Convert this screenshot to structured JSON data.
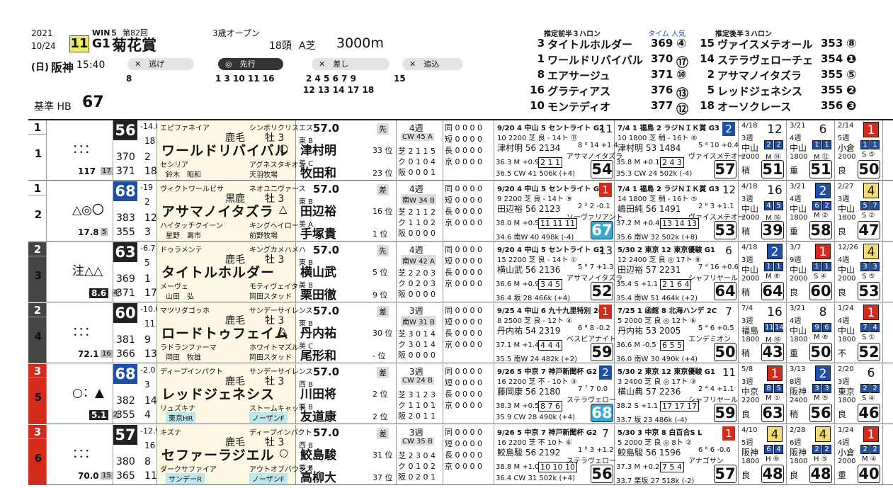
{
  "header": {
    "year": "2021",
    "date": "10/24",
    "win5": "WIN５",
    "race_count": "第82回",
    "race_num": "11",
    "grade": "G1",
    "race_name": "菊花賞",
    "day": "(日)",
    "venue": "阪神",
    "time": "15:40",
    "class": "3歳オープン",
    "heads": "18頭",
    "track": "A芝",
    "distance": "3000m",
    "base_label": "基準 HB",
    "base_value": "67"
  },
  "pace": {
    "nige_label": "逃げ",
    "nige_horses": "8",
    "senko_label": "先行",
    "senko_horses": "1 3 10 11 16",
    "sashi_label": "差し",
    "sashi_horses_1": "2 4 5 6 7 9",
    "sashi_horses_2": "12 13 14 17 18",
    "oikomi_label": "追込",
    "oikomi_horses": "15"
  },
  "rankings": {
    "first_half_title": "推定前半３ハロン",
    "time_label": "タイム 人気",
    "second_half_title": "推定後半３ハロン",
    "first_half": [
      {
        "num": "3",
        "name": "タイトルホルダー",
        "time": "369",
        "pop": "4"
      },
      {
        "num": "1",
        "name": "ワールドリバイバル",
        "time": "370",
        "pop": "17"
      },
      {
        "num": "8",
        "name": "エアサージュ",
        "time": "371",
        "pop": "10"
      },
      {
        "num": "16",
        "name": "グラティアス",
        "time": "376",
        "pop": "13"
      },
      {
        "num": "10",
        "name": "モンテディオ",
        "time": "377",
        "pop": "12"
      }
    ],
    "second_half": [
      {
        "num": "15",
        "name": "ヴァイスメテオール",
        "time": "353",
        "pop": "8"
      },
      {
        "num": "14",
        "name": "ステラヴェローチェ",
        "time": "354",
        "pop": "1"
      },
      {
        "num": "2",
        "name": "アサマノイタズラ",
        "time": "355",
        "pop": "5"
      },
      {
        "num": "5",
        "name": "レッドジェネシス",
        "time": "355",
        "pop": "2"
      },
      {
        "num": "18",
        "name": "オーソクレース",
        "time": "356",
        "pop": "3"
      }
    ]
  },
  "horses": [
    {
      "waku": "1",
      "umaban": "1",
      "marks": "：：：",
      "odds": "117",
      "pop": "17",
      "score": "56",
      "s1": "-14.0",
      "s2": "18",
      "s3": "370",
      "s3r": "2",
      "s4": "371",
      "s4r": "18",
      "sire": "エピファネイア",
      "dam_sire_top": "シンボリクリスエス",
      "coat": "鹿毛",
      "sex": "牡 3",
      "name": "ワールドリバイバル",
      "mark_end": "○",
      "dam": "セシリア",
      "dam_sire": "アグネスタキオン",
      "owner": "鈴木　昭和",
      "breeder": "天羽牧場",
      "weight": "57.0",
      "style": "先",
      "east_west": "東 B",
      "jockey": "津村明",
      "jrank": "33 位",
      "trainer_tag": "美 C",
      "trainer": "牧田和",
      "trank": "23 位",
      "rotation": "4週",
      "training": "CW 45 A",
      "stats": [
        "同 0 0 0 0",
        "短 0 0 0 0",
        "長 0 0 0 0",
        "芝 2 1 1 5",
        "京 0 0 0 0",
        "ク 0 1 0 4",
        "阪 0 0 0 1"
      ],
      "p1_head": "9/20  4 中山  5 セントライト  G2",
      "p1_pos": "11",
      "p1_l2": "10  2200  芝 良  -  14ト  ⑪",
      "p1_jockey": "津村明  56  2134",
      "p1_note": "8 ⁴ 14  +1.4",
      "p1_winner": "アサマノイタズラ",
      "p1_lap": "36.3  M +0.9",
      "p1_pass": "2 1 1",
      "p1_last": "36.5  CW 41  506k (+4)",
      "p1_score": "54",
      "p2_head": "7/4  1 福島  2 ラジＮＩＫ賞  G3",
      "p2_pos": "2",
      "p2_l2": "10  1800  芝 稍  -  16ト  ⑥",
      "p2_jockey": "津村明  53  1484",
      "p2_note": "5 ⁴ 10  +0.4",
      "p2_winner": "ヴァイスメテオー",
      "p2_lap": "35.8  M +0.1",
      "p2_pass": "2 4 3",
      "p2_last": "35.3  CW 24  502k (-4)",
      "p2_score": "57",
      "h3": {
        "date": "4/18",
        "n": "12",
        "w": "3週",
        "v": "中山",
        "d": "2000",
        "g": "稍",
        "sc": "51",
        "b1": "2",
        "b2": "2",
        "m": "M ⑭"
      },
      "h4": {
        "date": "3/21",
        "n": "6",
        "w": "4週",
        "v": "中山",
        "d": "1800",
        "g": "重",
        "sc": "51",
        "b1": "1",
        "b2": "1",
        "m": "M ⑫"
      },
      "h5": {
        "date": "2/14",
        "n": "1",
        "w": "5週",
        "v": "小倉",
        "d": "2000",
        "g": "良",
        "sc": "50",
        "b1": "1",
        "b2": "1",
        "m": "S ⑤"
      }
    },
    {
      "waku": "1",
      "umaban": "2",
      "marks": "△◎〇",
      "odds": "17.8",
      "pop": "5",
      "score": "68",
      "s1": "-19",
      "s2": "2",
      "s3": "383",
      "s3r": "12",
      "s4": "355",
      "s4r": "3",
      "sire": "ヴィクトワールピサ",
      "dam_sire_top": "ネオユニヴァース",
      "coat": "黒鹿",
      "sex": "牡 3",
      "name": "アサマノイタズラ",
      "mark_end": "△",
      "dam": "ハイタッチクイーン",
      "dam_sire": "キングヘイロー",
      "owner": "星野　壽市",
      "breeder": "前野牧場",
      "weight": "57.0",
      "style": "差",
      "east_west": "東 B",
      "jockey": "田辺裕",
      "jrank": "16 位",
      "trainer_tag": "美 A",
      "trainer": "手塚貴",
      "trank": "1 位",
      "rotation": "4週",
      "training": "南W 34 B",
      "stats": [
        "同 0 0 0 0",
        "短 0 0 0 0",
        "長 0 0 0 0",
        "芝 2 1 1 2",
        "京 0 0 0 0",
        "ク 1 1 0 2",
        "阪 0 0 0 0"
      ],
      "p1_head": "9/20  4 中山  5 セントライト  G2",
      "p1_pos": "1",
      "p1_l2": "9  2200  芝 良  -  14ト  ⑨",
      "p1_jockey": "田辺裕  56  2123",
      "p1_note": "2 ² 2  -0.1",
      "p1_winner": "ソーヴァリアント",
      "p1_lap": "38.0  M +0.5",
      "p1_pass": "11 11 11",
      "p1_last": "34.6  南W 40  498k (-4)",
      "p1_score": "67",
      "p2_head": "7/4  1 福島  2 ラジＮＩＫ賞  G3",
      "p2_pos": "12",
      "p2_l2": "14  1800  芝 稍  -  16ト  ⑤",
      "p2_jockey": "嶋田純  56  1491",
      "p2_note": "2 ⁸ 3  +1.1",
      "p2_winner": "ヴァイスメテオー",
      "p2_lap": "37.2  M +0.4",
      "p2_pass": "13 14 13",
      "p2_last": "35.6  南W 32  502k (+8)",
      "p2_score": "53",
      "h3": {
        "date": "4/18",
        "n": "16",
        "w": "3週",
        "v": "中山",
        "d": "2000",
        "g": "稍",
        "sc": "39",
        "b1": "4",
        "b2": "5",
        "m": "M ⑯"
      },
      "h4": {
        "date": "3/21",
        "n": "2",
        "w": "4週",
        "v": "中山",
        "d": "1800",
        "g": "重",
        "sc": "58",
        "b1": "6",
        "b2": "2",
        "m": "M ②"
      },
      "h5": {
        "date": "2/27",
        "n": "4",
        "w": "3週",
        "v": "中山",
        "d": "1800",
        "g": "良",
        "sc": "47",
        "b1": "5",
        "b2": "7",
        "m": "S ②"
      }
    },
    {
      "waku": "2",
      "umaban": "3",
      "marks": "注△△",
      "odds": "8.6",
      "pop": "4",
      "score": "63",
      "s1": "-6.7",
      "s2": "5",
      "s3": "369",
      "s3r": "1",
      "s4": "371",
      "s4r": "17",
      "sire": "ドゥラメンテ",
      "dam_sire_top": "キングカメハメハ",
      "coat": "鹿毛",
      "sex": "牡 3",
      "name": "タイトルホルダー",
      "mark_end": "",
      "dam": "メーヴェ",
      "dam_sire": "モティヴェイター",
      "owner": "山田　弘",
      "breeder": "岡田スタッド",
      "weight": "57.0",
      "style": "先",
      "east_west": "東 B",
      "jockey": "横山武",
      "jrank": "5 位",
      "trainer_tag": "美 B",
      "trainer": "栗田徹",
      "trank": "9 位",
      "rotation": "4週",
      "training": "南W 42 A",
      "stats": [
        "同 0 0 0 0",
        "短 0 0 0 0",
        "長 0 0 0 0",
        "芝 2 2 0 3",
        "京 0 0 0 0",
        "ク 0 2 0 3",
        "阪 0 0 0 0"
      ],
      "p1_head": "9/20  4 中山  5 セントライト  G2",
      "p1_pos": "13",
      "p1_l2": "15  2200  芝 良  -  14ト  ①",
      "p1_jockey": "横山武  56  2136",
      "p1_note": "5 ⁸ 7  +1.3",
      "p1_winner": "アサマノイタズラ",
      "p1_lap": "36.6  M +0.9",
      "p1_pass": "3 4 5",
      "p1_last": "36.4  坂 28  466k (+4)",
      "p1_score": "52",
      "p2_head": "5/30  2 東京  12 東京優駿  G1",
      "p2_pos": "6",
      "p2_l2": "12  2400  芝 良  ◎  17ト  ⑧",
      "p2_jockey": "田辺裕  57  2231",
      "p2_note": "7 ⁴ 16  +0.6",
      "p2_winner": "シャフリヤール",
      "p2_lap": "35.4  S +1.1",
      "p2_pass": "2 1 6 4",
      "p2_last": "35.4  南W 51  464k (+2)",
      "p2_score": "64",
      "h3": {
        "date": "4/18",
        "n": "2",
        "w": "3週",
        "v": "中山",
        "d": "2000",
        "g": "稍",
        "sc": "64",
        "b1": "1",
        "b2": "1",
        "m": "M ⑧"
      },
      "h4": {
        "date": "3/7",
        "n": "1",
        "w": "9週",
        "v": "中山",
        "d": "2000",
        "g": "良",
        "sc": "60",
        "b1": "1",
        "b2": "1",
        "m": "S ④"
      },
      "h5": {
        "date": "12/26",
        "n": "4",
        "w": "4週",
        "v": "中山",
        "d": "2000",
        "g": "良",
        "sc": "53",
        "b1": "3",
        "b2": "3",
        "m": "S ⑤"
      }
    },
    {
      "waku": "2",
      "umaban": "4",
      "marks": "：：：",
      "odds": "72.1",
      "pop": "16",
      "score": "60",
      "s1": "-10.0",
      "s2": "11",
      "s3": "381",
      "s3r": "9",
      "s4": "366",
      "s4r": "13",
      "sire": "マツリダゴッホ",
      "dam_sire_top": "サンデーサイレンス",
      "coat": "鹿毛",
      "sex": "牡 3",
      "name": "ロードトゥフェイム",
      "mark_end": "△",
      "dam": "ラドランファーマ",
      "dam_sire": "ホワイトマズル",
      "owner": "岡田　牧雄",
      "breeder": "岡田スタッド",
      "weight": "57.0",
      "style": "差",
      "east_west": "東 B",
      "jockey": "丹内祐",
      "jrank": "30 位",
      "trainer_tag": "美 C",
      "trainer": "尾形和",
      "trank": "- 位",
      "rotation": "3週",
      "training": "南W 31 B",
      "stats": [
        "同 0 0 0 0",
        "短 0 0 0 0",
        "長 0 0 0 0",
        "芝 3 0 1 4",
        "京 0 0 0 0",
        "ク 3 0 1 4",
        "阪 0 0 0 0"
      ],
      "p1_head": "9/25  4 中山  6 九十九里特別  2C",
      "p1_pos": "1",
      "p1_l2": "8  2500  芝 良  -  12ト  ④",
      "p1_jockey": "丹内祐  54  2319",
      "p1_note": "6 ⁸ 8  -0.2",
      "p1_winner": "ベスビアナイト",
      "p1_lap": "37.1  M +1.4",
      "p1_pass": "4 4 4",
      "p1_last": "35.5  南W 24  482k (+2)",
      "p1_score": "59",
      "p2_head": "7/25  1 函館  8 北海ハンデ  2C",
      "p2_pos": "7",
      "p2_l2": "5  2000  芝 良  ◎  12ト  ⑥",
      "p2_jockey": "丹内祐  53  2005",
      "p2_note": "5 ⁴ 6  +0.5",
      "p2_winner": "エンデミオン",
      "p2_lap": "36.6  M -0.5",
      "p2_pass": "6 5 5",
      "p2_last": "36.0  南W 30  490k (+4)",
      "p2_score": "50",
      "h3": {
        "date": "7/4",
        "n": "16",
        "w": "3週",
        "v": "福島",
        "d": "1800",
        "g": "稍",
        "sc": "43",
        "b1": "11",
        "b2": "14",
        "m": "M ⑯"
      },
      "h4": {
        "date": "3/21",
        "n": "8",
        "w": "4週",
        "v": "中山",
        "d": "1800",
        "g": "重",
        "sc": "50",
        "b1": "9",
        "b2": "6",
        "m": "M ⑧"
      },
      "h5": {
        "date": "1/24",
        "n": "1",
        "w": "4週",
        "v": "中山",
        "d": "1800",
        "g": "不",
        "sc": "52",
        "b1": "7",
        "b2": "4",
        "m": "S ①"
      }
    },
    {
      "waku": "3",
      "umaban": "5",
      "marks": "○：▲",
      "odds": "5.1",
      "pop": "2",
      "score": "68",
      "s1": "-2.0",
      "s2": "3",
      "s3": "382",
      "s3r": "14",
      "s4": "355",
      "s4r": "4",
      "sire": "ディープインパクト",
      "dam_sire_top": "サンデーサイレンス",
      "coat": "鹿毛",
      "sex": "牡 3",
      "name": "レッドジェネシス",
      "mark_end": "",
      "dam": "リュズキナ",
      "dam_sire": "ストームキャット",
      "owner": "東京HR",
      "breeder": "ノーザンF",
      "weight": "57.0",
      "style": "差",
      "east_west": "西 B",
      "jockey": "川田将",
      "jrank": "2 位",
      "trainer_tag": "栗 B",
      "trainer": "友道康",
      "trank": "2 位",
      "rotation": "3週",
      "training": "CW 24 B",
      "stats": [
        "同 0 0 0 0",
        "短 0 0 0 0",
        "長 0 0 0 0",
        "芝 3 1 2 3",
        "京 0 0 0 0",
        "ク 1 1 0 1",
        "阪 2 0 1 1"
      ],
      "p1_head": "9/26  5 中京  7 神戸新聞杯  G2",
      "p1_pos": "2",
      "p1_l2": "16  2200  芝 不  -  10ト  ③",
      "p1_jockey": "藤岡康  56  2180",
      "p1_note": "7 ⁷ 7  0.0",
      "p1_winner": "ステラヴェロー",
      "p1_lap": "38.3  M +0.5",
      "p1_pass": "8 7 6",
      "p1_last": "35.9  CW 28  490k (+4)",
      "p1_score": "68",
      "p2_head": "5/30  2 東京  12 東京優駿  G1",
      "p2_pos": "11",
      "p2_l2": "3  2400  芝 良  ◎  17ト  ③",
      "p2_jockey": "横山典  57  2236",
      "p2_note": "2 ⁴ 4  +1.1",
      "p2_winner": "シャフリヤール",
      "p2_lap": "38.2  S +1.1",
      "p2_pass": "17 17 17",
      "p2_last": "33.7  坂 23  486k (-4)",
      "p2_score": "59",
      "h3": {
        "date": "5/8",
        "n": "1",
        "w": "3週",
        "v": "中京",
        "d": "2200",
        "g": "良",
        "sc": "63",
        "b1": "8",
        "b2": "5",
        "m": "M ①"
      },
      "h4": {
        "date": "3/13",
        "n": "2",
        "w": "8週",
        "v": "阪神",
        "d": "2400",
        "g": "稍",
        "sc": "56",
        "b1": "3",
        "b2": "3",
        "m": "M ⑤"
      },
      "h5": {
        "date": "2/20",
        "n": "6",
        "w": "3週",
        "v": "東京",
        "d": "1800",
        "g": "良",
        "sc": "46",
        "b1": "2",
        "b2": "2",
        "m": "S ④"
      }
    },
    {
      "waku": "3",
      "umaban": "6",
      "marks": "：：：",
      "odds": "70.0",
      "pop": "15",
      "score": "57",
      "s1": "-12.9",
      "s2": "16",
      "s3": "380",
      "s3r": "8",
      "s4": "365",
      "s4r": "11",
      "sire": "キズナ",
      "dam_sire_top": "ディープインパクト",
      "coat": "鹿毛",
      "sex": "牡 3",
      "name": "セファーラジエル",
      "mark_end": "○",
      "dam": "ダークサファイア",
      "dam_sire": "アウトオブバウンズ",
      "owner": "サンデーR",
      "breeder": "ノーザンF",
      "weight": "57.0",
      "style": "差",
      "east_west": "西 B",
      "jockey": "鮫島駿",
      "jrank": "31 位",
      "trainer_tag": "栗 B",
      "trainer": "高柳大",
      "trank": "37 位",
      "rotation": "3週",
      "training": "CW 35 B",
      "stats": [
        "同 0 0 0 0",
        "短 0 0 0 0",
        "長 0 0 0 0",
        "芝 2 3 0 4",
        "京 0 0 0 0",
        "ク 0 1 0 2",
        "阪 0 2 0 1"
      ],
      "p1_head": "9/26  5 中京  7 神戸新聞杯  G2",
      "p1_pos": "7",
      "p1_l2": "16  2200  芝 不  10ト  ⑥",
      "p1_jockey": "鮫島駿  56  2192",
      "p1_note": "1 ⁰ 3  +1.2",
      "p1_winner": "ステラヴェロー",
      "p1_lap": "38.8  M +1.0",
      "p1_pass": "10 10 10",
      "p1_last": "36.4  CW 31  502k (+4)",
      "p1_score": "56",
      "p2_head": "5/30  3 中京  8 白百合S  L",
      "p2_pos": "1",
      "p2_l2": "5  2000  芝 良  ◎  8ト  ②",
      "p2_jockey": "鮫島駿  56  1596",
      "p2_note": "6 ⁶ 6  -0.6",
      "p2_winner": "アナゴサン",
      "p2_lap": "37.3  M +0.2",
      "p2_pass": "7 5 4",
      "p2_last": "33.7  栗坂 27  518k (-2)",
      "p2_score": "57",
      "h3": {
        "date": "4/10",
        "n": "4",
        "w": "5週",
        "v": "阪神",
        "d": "1800",
        "g": "良",
        "sc": "48",
        "b1": "6",
        "b2": "4",
        "m": "H ⑥"
      },
      "h4": {
        "date": "2/28",
        "n": "4",
        "w": "6週",
        "v": "阪神",
        "d": "1800",
        "g": "良",
        "sc": "48",
        "b1": "2",
        "b2": "2",
        "m": "H ⑤"
      },
      "h5": {
        "date": "1/24",
        "n": "1",
        "w": "4週",
        "v": "小倉",
        "d": "2000",
        "g": "重",
        "sc": "40",
        "b1": "2",
        "b2": "2",
        "m": "M ④"
      }
    }
  ]
}
